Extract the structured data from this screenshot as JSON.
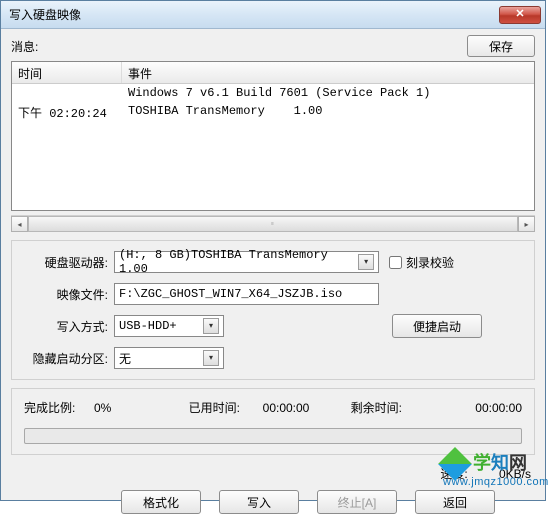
{
  "window": {
    "title": "写入硬盘映像"
  },
  "top": {
    "message_label": "消息:",
    "save_label": "保存"
  },
  "list": {
    "head_time": "时间",
    "head_event": "事件",
    "rows": [
      {
        "time": "",
        "event": "Windows 7 v6.1 Build 7601 (Service Pack 1)"
      },
      {
        "time": "下午 02:20:24",
        "event": "TOSHIBA TransMemory    1.00"
      }
    ]
  },
  "fields": {
    "drive_label": "硬盘驱动器:",
    "drive_value": "(H:, 8 GB)TOSHIBA TransMemory    1.00",
    "verify_label": "刻录校验",
    "image_label": "映像文件:",
    "image_value": "F:\\ZGC_GHOST_WIN7_X64_JSZJB.iso",
    "write_mode_label": "写入方式:",
    "write_mode_value": "USB-HDD+",
    "quick_boot_label": "便捷启动",
    "hidden_label": "隐藏启动分区:",
    "hidden_value": "无"
  },
  "progress": {
    "done_label": "完成比例:",
    "done_value": "0%",
    "elapsed_label": "已用时间:",
    "elapsed_value": "00:00:00",
    "remain_label": "剩余时间:",
    "remain_value": "00:00:00",
    "speed_label": "速度:",
    "speed_value": "0KB/s"
  },
  "buttons": {
    "format": "格式化",
    "write": "写入",
    "abort": "终止[A]",
    "back": "返回"
  },
  "watermark": {
    "c1": "学",
    "c2": "知",
    "c3": "网",
    "url": "www.jmqz1000.com"
  }
}
